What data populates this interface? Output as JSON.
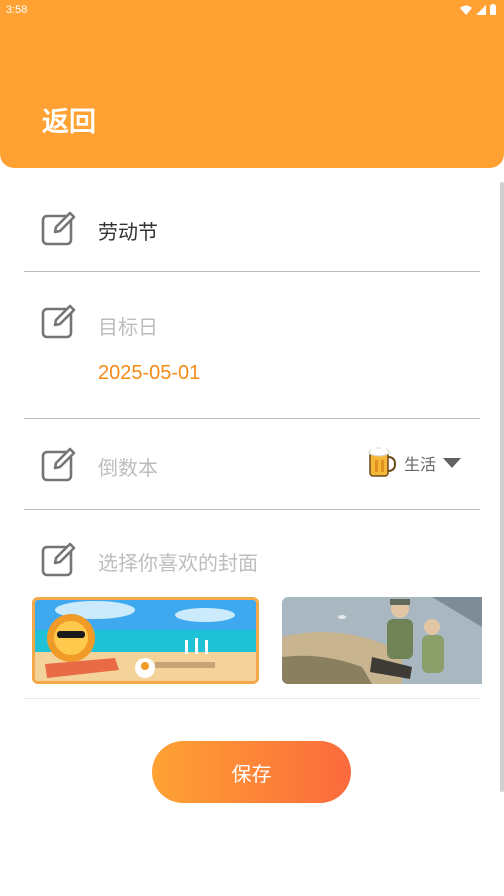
{
  "status_bar": {
    "time": "3:58"
  },
  "header": {
    "back_label": "返回"
  },
  "form": {
    "name": {
      "value": "劳动节"
    },
    "target_date": {
      "placeholder": "目标日",
      "value": "2025-05-01"
    },
    "notebook": {
      "placeholder": "倒数本",
      "category_label": "生活",
      "category_icon": "beer-mug-icon"
    },
    "cover": {
      "placeholder": "选择你喜欢的封面",
      "selected_index": 0
    }
  },
  "actions": {
    "save_label": "保存"
  },
  "colors": {
    "header": "#FFA233",
    "accent_date": "#F48B17",
    "save_start": "#FFA233",
    "save_end": "#FB6A3C"
  }
}
